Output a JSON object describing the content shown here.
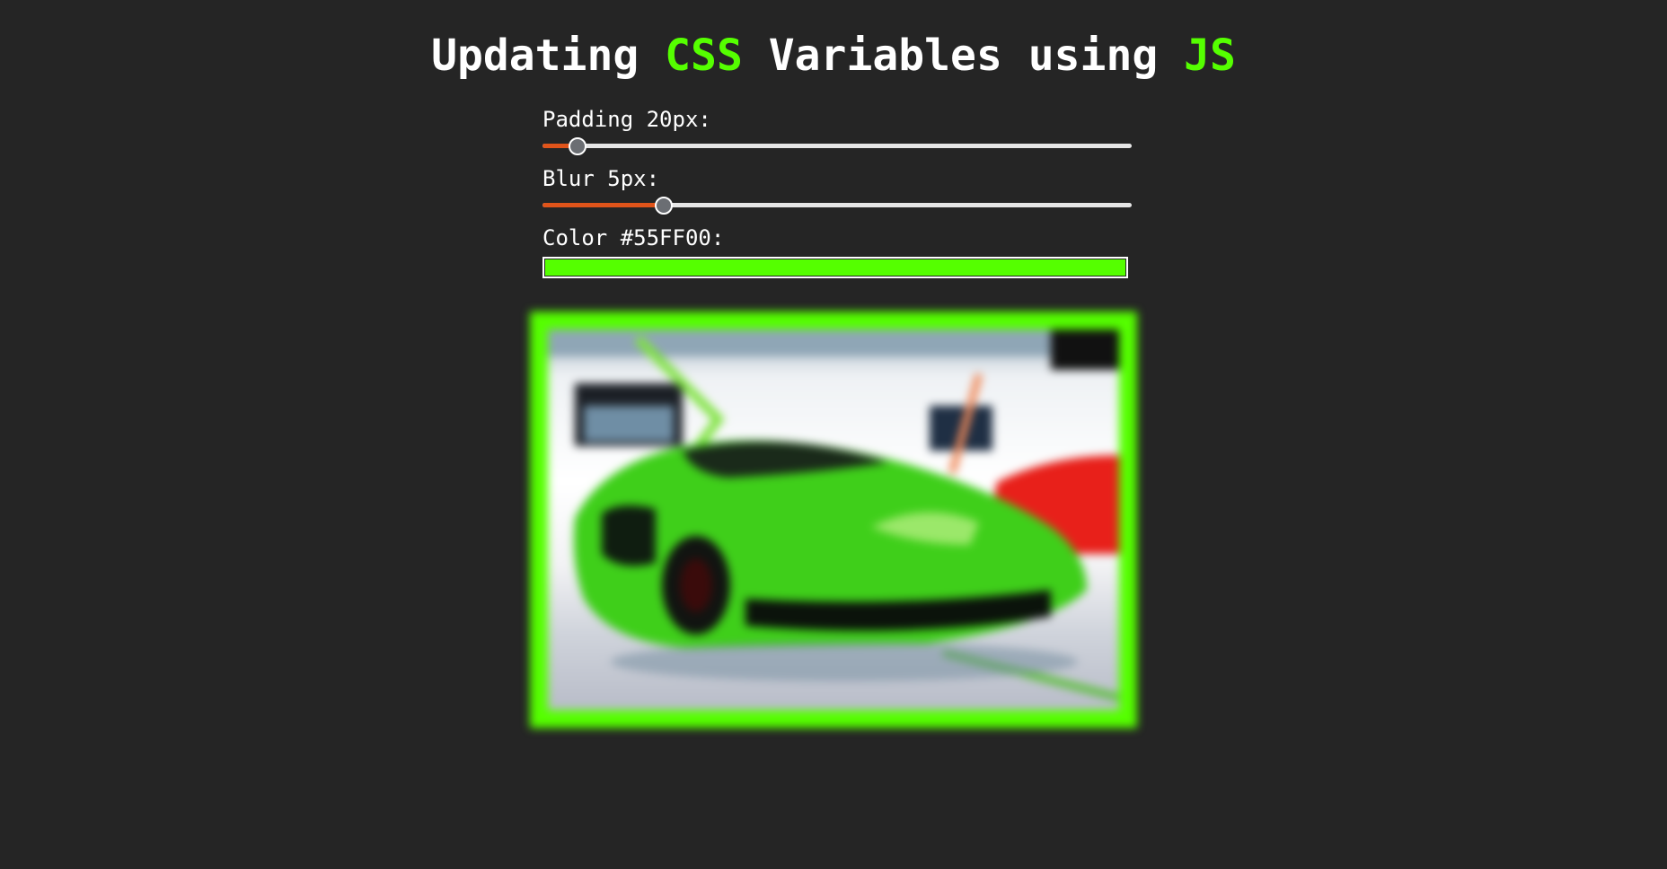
{
  "header": {
    "title_part1": "Updating ",
    "title_css": "CSS",
    "title_part2": " Variables using ",
    "title_js": "JS"
  },
  "controls": {
    "padding": {
      "label": "Padding 20px:",
      "value": 20,
      "min": 10,
      "max": 200
    },
    "blur": {
      "label": "Blur 5px:",
      "value": 5,
      "min": 0,
      "max": 25
    },
    "color": {
      "label": "Color #55FF00:",
      "value": "#55FF00"
    }
  },
  "colors": {
    "accent": "#55ff00",
    "slider_fill": "#e0541a",
    "background": "#252525"
  },
  "image": {
    "alt_icon": "green-sports-car-photo"
  }
}
